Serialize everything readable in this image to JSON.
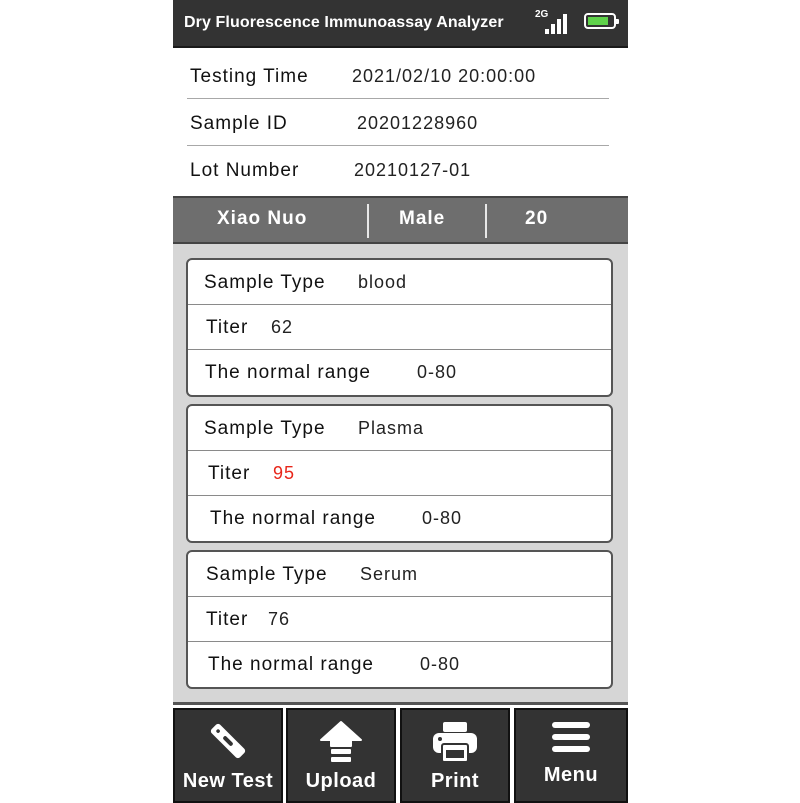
{
  "header": {
    "title": "Dry Fluorescence Immunoassay Analyzer",
    "network_label": "2G",
    "signal_icon": "signal-bars-icon",
    "battery_icon": "battery-icon",
    "battery_level": 0.85,
    "battery_color": "#5fd24a"
  },
  "info": {
    "testing_time": {
      "label": "Testing Time",
      "value": "2021/02/10  20:00:00"
    },
    "sample_id": {
      "label": "Sample ID",
      "value": "20201228960"
    },
    "lot_number": {
      "label": "Lot Number",
      "value": "20210127-01"
    }
  },
  "patient": {
    "name": "Xiao  Nuo",
    "gender": "Male",
    "age": "20"
  },
  "results": [
    {
      "sample_type_label": "Sample Type",
      "sample_type": "blood",
      "titer_label": "Titer",
      "titer": "62",
      "range_label": "The normal range",
      "range": "0-80",
      "abnormal": false
    },
    {
      "sample_type_label": "Sample Type",
      "sample_type": "Plasma",
      "titer_label": "Titer",
      "titer": "95",
      "range_label": "The normal range",
      "range": "0-80",
      "abnormal": true
    },
    {
      "sample_type_label": "Sample Type",
      "sample_type": "Serum",
      "titer_label": "Titer",
      "titer": "76",
      "range_label": "The normal range",
      "range": "0-80",
      "abnormal": false
    }
  ],
  "colors": {
    "alert": "#e8261a",
    "titlebar": "#333333",
    "patient_bar": "#6e6e6e"
  },
  "toolbar": {
    "new_test": {
      "label": "New Test",
      "icon": "test-strip-icon"
    },
    "upload": {
      "label": "Upload",
      "icon": "upload-arrow-icon"
    },
    "print": {
      "label": "Print",
      "icon": "printer-icon"
    },
    "menu": {
      "label": "Menu",
      "icon": "hamburger-menu-icon"
    }
  }
}
